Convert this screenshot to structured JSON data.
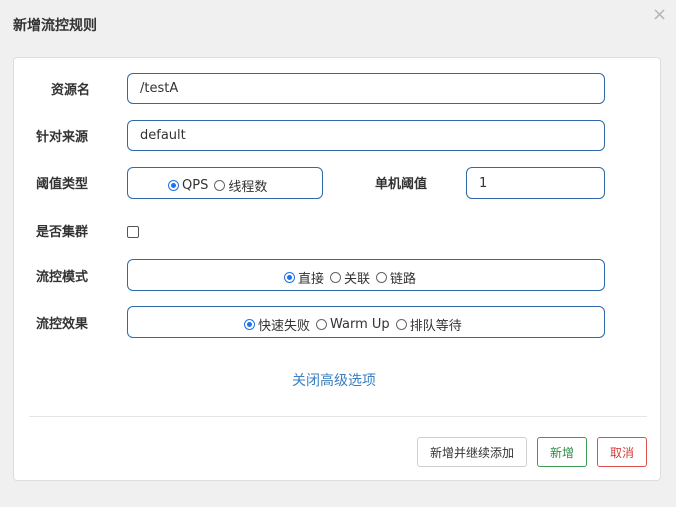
{
  "dialog": {
    "title": "新增流控规则",
    "close_glyph": "×"
  },
  "form": {
    "resource_name": {
      "label": "资源名",
      "value": "/testA"
    },
    "limit_app": {
      "label": "针对来源",
      "value": "default"
    },
    "threshold_type": {
      "label": "阈值类型",
      "options": [
        "QPS",
        "线程数"
      ],
      "selected": "QPS"
    },
    "single_threshold": {
      "label": "单机阈值",
      "value": "1"
    },
    "cluster_mode": {
      "label": "是否集群",
      "checked": false
    },
    "control_mode": {
      "label": "流控模式",
      "options": [
        "直接",
        "关联",
        "链路"
      ],
      "selected": "直接"
    },
    "control_effect": {
      "label": "流控效果",
      "options": [
        "快速失败",
        "Warm Up",
        "排队等待"
      ],
      "selected": "快速失败"
    },
    "advanced_link": "关闭高级选项"
  },
  "footer": {
    "add_continue_label": "新增并继续添加",
    "add_label": "新增",
    "cancel_label": "取消"
  },
  "colors": {
    "input_border": "#2f6aa8",
    "radio_checked": "#1e73e8",
    "link": "#3a7fc1",
    "success": "#2e8b45",
    "danger": "#d23f3a"
  }
}
